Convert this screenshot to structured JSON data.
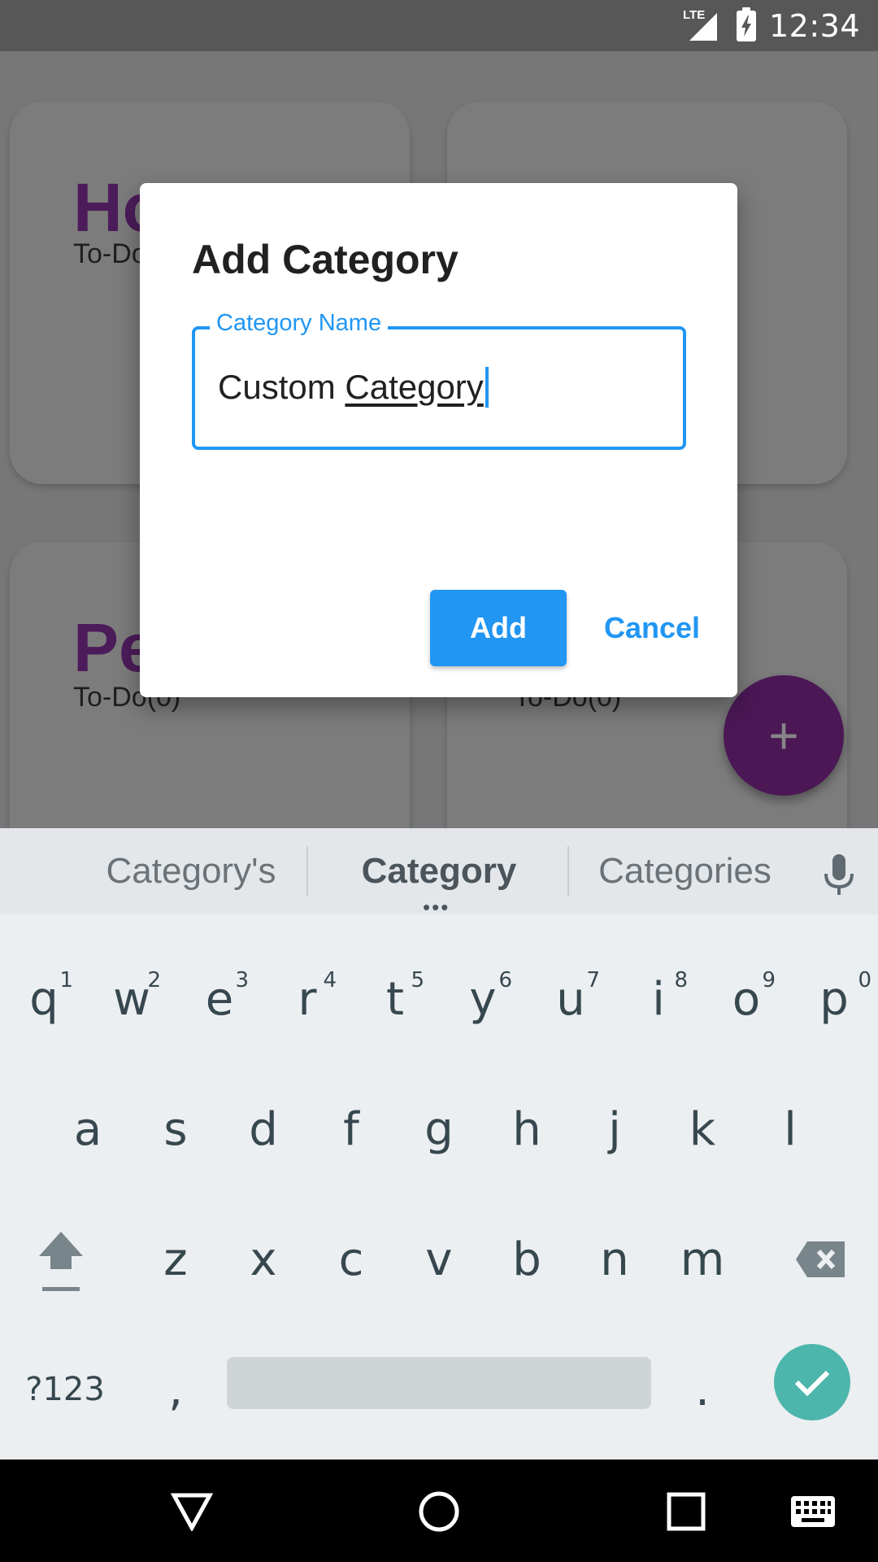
{
  "status_bar": {
    "network": "LTE",
    "time": "12:34"
  },
  "cards": [
    {
      "title": "Ho",
      "subtitle": "To-Do"
    },
    {
      "title": "",
      "subtitle": ""
    },
    {
      "title": "Pe",
      "subtitle": "To-Do(0)"
    },
    {
      "title": "",
      "subtitle": "To-Do(0)"
    }
  ],
  "fab": {
    "label": "+"
  },
  "dialog": {
    "title": "Add Category",
    "field_label": "Category Name",
    "field_value_plain": "Custom ",
    "field_value_composing": "Category",
    "add_label": "Add",
    "cancel_label": "Cancel"
  },
  "keyboard": {
    "suggestions": [
      "Category's",
      "Category",
      "Categories"
    ],
    "row1": [
      {
        "key": "q",
        "hint": "1"
      },
      {
        "key": "w",
        "hint": "2"
      },
      {
        "key": "e",
        "hint": "3"
      },
      {
        "key": "r",
        "hint": "4"
      },
      {
        "key": "t",
        "hint": "5"
      },
      {
        "key": "y",
        "hint": "6"
      },
      {
        "key": "u",
        "hint": "7"
      },
      {
        "key": "i",
        "hint": "8"
      },
      {
        "key": "o",
        "hint": "9"
      },
      {
        "key": "p",
        "hint": "0"
      }
    ],
    "row2": [
      "a",
      "s",
      "d",
      "f",
      "g",
      "h",
      "j",
      "k",
      "l"
    ],
    "row3": [
      "z",
      "x",
      "c",
      "v",
      "b",
      "n",
      "m"
    ],
    "symbols_label": "?123",
    "comma_label": ",",
    "period_label": ".",
    "accent_color": "#4db6ac"
  },
  "colors": {
    "primary": "#2196f3",
    "card_title": "#4c1c5a",
    "fab": "#4b1855"
  }
}
